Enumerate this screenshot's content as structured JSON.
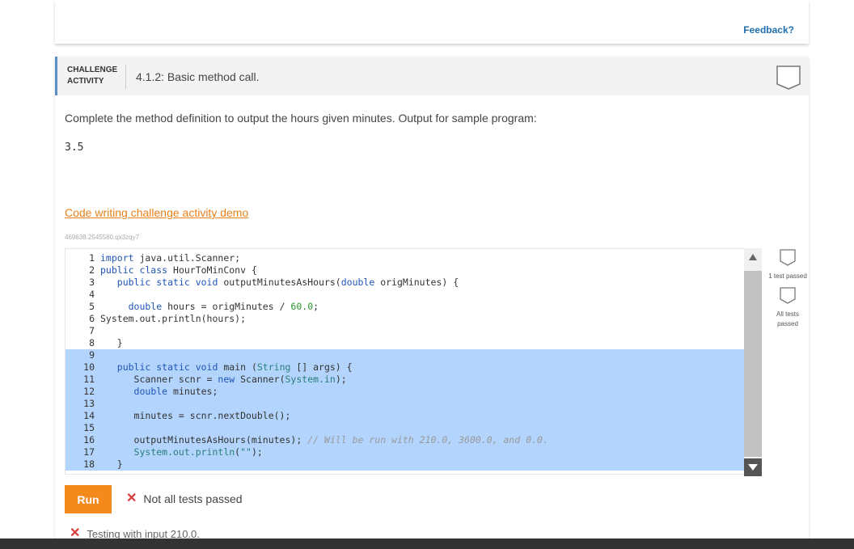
{
  "top": {
    "feedback_label": "Feedback?"
  },
  "activity": {
    "type_line1": "CHALLENGE",
    "type_line2": "ACTIVITY",
    "title": "4.1.2: Basic method call.",
    "prompt": "Complete the method definition to output the hours given minutes. Output for sample program:",
    "sample_output": "3.5",
    "demo_link": "Code writing challenge activity demo",
    "hash_id": "469638.2545580.qx3zqy7"
  },
  "editor": {
    "lines": [
      {
        "n": "1",
        "html": "<span class=\"kw\">import</span> java.util.Scanner;"
      },
      {
        "n": "2",
        "html": "<span class=\"kw\">public class</span> HourToMinConv {"
      },
      {
        "n": "3",
        "html": "   <span class=\"kw\">public static void</span> outputMinutesAsHours(<span class=\"kw\">double</span> origMinutes) {"
      },
      {
        "n": "4",
        "html": ""
      },
      {
        "n": "5",
        "html": "     <span class=\"kw\">double</span> hours = origMinutes / <span class=\"num\">60.0</span>;"
      },
      {
        "n": "6",
        "html": "System.out.println(hours);"
      },
      {
        "n": "7",
        "html": ""
      },
      {
        "n": "8",
        "html": "   }"
      },
      {
        "n": "9",
        "html": ""
      },
      {
        "n": "10",
        "html": "   <span class=\"kw\">public static void</span> main (<span class=\"str\">String</span> [] args) {"
      },
      {
        "n": "11",
        "html": "      Scanner scnr = <span class=\"kw\">new</span> Scanner(<span class=\"str\">System.in</span>);"
      },
      {
        "n": "12",
        "html": "      <span class=\"kw\">double</span> minutes;"
      },
      {
        "n": "13",
        "html": ""
      },
      {
        "n": "14",
        "html": "      minutes = scnr.nextDouble();"
      },
      {
        "n": "15",
        "html": ""
      },
      {
        "n": "16",
        "html": "      outputMinutesAsHours(minutes); <span class=\"cm\">// Will be run with 210.0, 3600.0, and 0.0.</span>"
      },
      {
        "n": "17",
        "html": "      <span class=\"str\">System.out.println</span>(<span class=\"str\">\"\"</span>);"
      },
      {
        "n": "18",
        "html": "   }"
      }
    ]
  },
  "tests": {
    "one_label": "1 test passed",
    "all_label": "All tests passed"
  },
  "actions": {
    "run_label": "Run",
    "status": "Not all tests passed",
    "testing": "Testing with input 210.0."
  },
  "colors": {
    "accent": "#f48a1c",
    "link": "#1f6fb0",
    "selection": "#b3d4fc",
    "error": "#d93a3a"
  }
}
